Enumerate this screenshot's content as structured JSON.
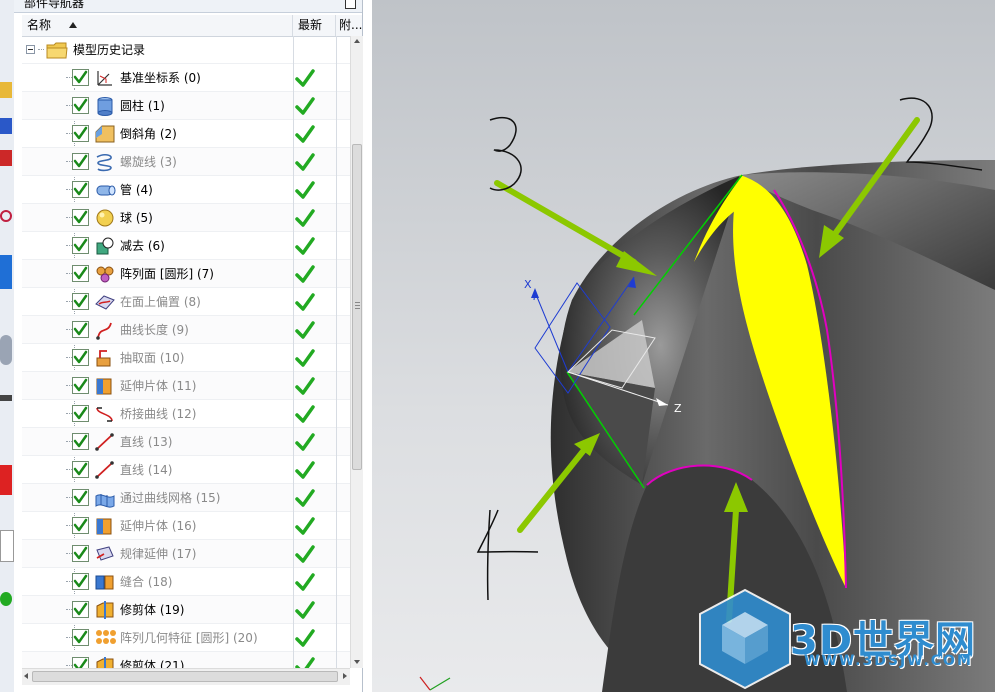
{
  "panel": {
    "title": "部件导航器",
    "columns": {
      "name": "名称",
      "latest": "最新",
      "attach": "附..."
    },
    "root_label": "模型历史记录",
    "features": [
      {
        "label": "基准坐标系 (0)",
        "icon": "datum-csys-icon",
        "dim": false
      },
      {
        "label": "圆柱 (1)",
        "icon": "cylinder-icon",
        "dim": false
      },
      {
        "label": "倒斜角 (2)",
        "icon": "chamfer-icon",
        "dim": false
      },
      {
        "label": "螺旋线 (3)",
        "icon": "helix-icon",
        "dim": true
      },
      {
        "label": "管 (4)",
        "icon": "tube-icon",
        "dim": false
      },
      {
        "label": "球 (5)",
        "icon": "sphere-icon",
        "dim": false
      },
      {
        "label": "减去 (6)",
        "icon": "subtract-icon",
        "dim": false
      },
      {
        "label": "阵列面 [圆形] (7)",
        "icon": "pattern-face-icon",
        "dim": false
      },
      {
        "label": "在面上偏置 (8)",
        "icon": "offset-on-face-icon",
        "dim": true
      },
      {
        "label": "曲线长度 (9)",
        "icon": "curve-length-icon",
        "dim": true
      },
      {
        "label": "抽取面 (10)",
        "icon": "extract-face-icon",
        "dim": true
      },
      {
        "label": "延伸片体 (11)",
        "icon": "extend-sheet-icon",
        "dim": true
      },
      {
        "label": "桥接曲线 (12)",
        "icon": "bridge-curve-icon",
        "dim": true
      },
      {
        "label": "直线 (13)",
        "icon": "line-icon",
        "dim": true
      },
      {
        "label": "直线 (14)",
        "icon": "line-icon",
        "dim": true
      },
      {
        "label": "通过曲线网格 (15)",
        "icon": "curve-mesh-icon",
        "dim": true
      },
      {
        "label": "延伸片体 (16)",
        "icon": "extend-sheet-icon",
        "dim": true
      },
      {
        "label": "规律延伸 (17)",
        "icon": "law-extension-icon",
        "dim": true
      },
      {
        "label": "缝合 (18)",
        "icon": "sew-icon",
        "dim": true
      },
      {
        "label": "修剪体 (19)",
        "icon": "trim-body-icon",
        "dim": false
      },
      {
        "label": "阵列几何特征 [圆形] (20)",
        "icon": "pattern-geometry-icon",
        "dim": true
      },
      {
        "label": "修剪体 (21)",
        "icon": "trim-body-icon",
        "dim": false
      }
    ]
  },
  "viewport": {
    "axis_labels": {
      "x": "X",
      "z": "Z"
    },
    "handwritten_marks": [
      "3",
      "2",
      "4"
    ],
    "colors": {
      "highlight": "#ffff00",
      "edge": "#e000c0",
      "arrow": "#8cc800",
      "green_edge": "#00d000"
    }
  },
  "watermark": {
    "brand": "3D世界网",
    "url": "WWW.3DSJW.COM"
  }
}
